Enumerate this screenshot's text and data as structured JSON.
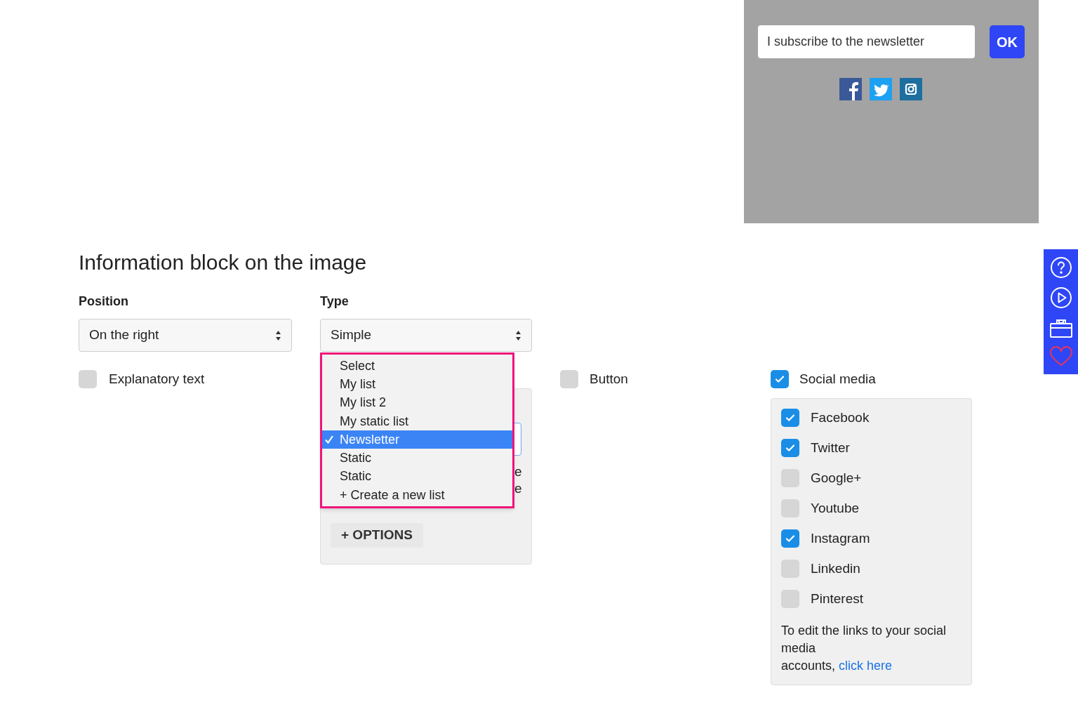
{
  "preview": {
    "email_placeholder": "I subscribe to the newsletter",
    "ok_button": "OK",
    "social_icons": [
      {
        "kind": "facebook",
        "color": "#3b5998"
      },
      {
        "kind": "twitter",
        "color": "#1da1f2"
      },
      {
        "kind": "instagram",
        "color": "#1d6fa0"
      }
    ]
  },
  "section_title": "Information block on the image",
  "position": {
    "label": "Position",
    "value": "On the right"
  },
  "type": {
    "label": "Type",
    "value": "Simple"
  },
  "options": [
    {
      "label": "Explanatory text",
      "checked": false
    },
    {
      "label": "Button",
      "checked": false
    },
    {
      "label": "Social media",
      "checked": true
    }
  ],
  "list_dropdown": {
    "items": [
      {
        "label": "Select",
        "selected": false
      },
      {
        "label": "My list",
        "selected": false
      },
      {
        "label": "My list 2",
        "selected": false
      },
      {
        "label": "My static list",
        "selected": false
      },
      {
        "label": "Newsletter",
        "selected": true
      },
      {
        "label": "Static",
        "selected": false
      },
      {
        "label": "Static",
        "selected": false
      },
      {
        "label": "+ Create a new list",
        "selected": false
      }
    ]
  },
  "type_panel": {
    "text_fragments": [
      "e",
      "e"
    ],
    "options_button": "+ OPTIONS"
  },
  "social_networks": [
    {
      "label": "Facebook",
      "checked": true
    },
    {
      "label": "Twitter",
      "checked": true
    },
    {
      "label": "Google+",
      "checked": false
    },
    {
      "label": "Youtube",
      "checked": false
    },
    {
      "label": "Instagram",
      "checked": true
    },
    {
      "label": "Linkedin",
      "checked": false
    },
    {
      "label": "Pinterest",
      "checked": false
    }
  ],
  "social_note": {
    "lines": [
      "To edit the links to your social media",
      "accounts,"
    ],
    "link": "click here"
  },
  "side_toolbar": [
    {
      "kind": "help"
    },
    {
      "kind": "play"
    },
    {
      "kind": "toolbox"
    },
    {
      "kind": "heart"
    }
  ]
}
